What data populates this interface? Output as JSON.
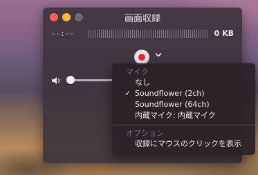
{
  "window": {
    "title": "画面収録"
  },
  "recording": {
    "time": "--:--",
    "file_size": "0 KB"
  },
  "volume": {
    "level": 0.0
  },
  "menu": {
    "microphone_header": "マイク",
    "microphone_options": [
      {
        "label": "なし",
        "checked": false
      },
      {
        "label": "Soundflower (2ch)",
        "checked": true
      },
      {
        "label": "Soundflower (64ch)",
        "checked": false
      },
      {
        "label": "内蔵マイク: 内蔵マイク",
        "checked": false
      }
    ],
    "options_header": "オプション",
    "show_mouse_clicks_label": "収録にマウスのクリックを表示",
    "check_glyph": "✓"
  },
  "icons": {
    "record": "record-icon",
    "chevron": "chevron-down-icon",
    "volume": "speaker-icon"
  },
  "colors": {
    "record_red": "#e8243b",
    "close": "#ff5f57",
    "minimize": "#febc2e"
  }
}
